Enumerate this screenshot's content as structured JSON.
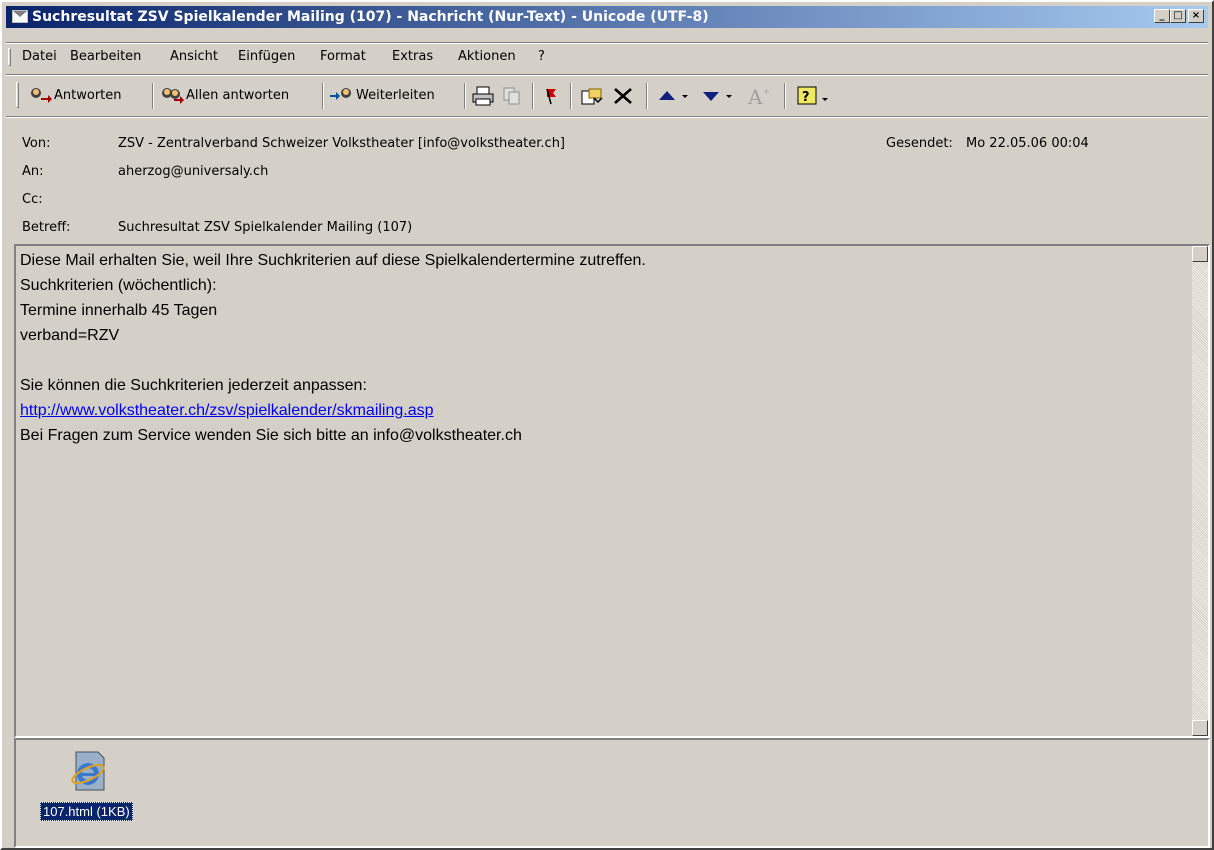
{
  "window": {
    "title": "Suchresultat ZSV Spielkalender Mailing (107) - Nachricht (Nur-Text)  - Unicode (UTF-8)",
    "controls": {
      "minimize": "_",
      "maximize": "□",
      "close": "×"
    }
  },
  "menu": {
    "items": [
      "Datei",
      "Bearbeiten",
      "Ansicht",
      "Einfügen",
      "Format",
      "Extras",
      "Aktionen",
      "?"
    ]
  },
  "toolbar": {
    "reply": "Antworten",
    "reply_all": "Allen antworten",
    "forward": "Weiterleiten"
  },
  "header": {
    "from_label": "Von:",
    "from_value": "ZSV - Zentralverband Schweizer Volkstheater [info@volkstheater.ch]",
    "sent_label": "Gesendet:",
    "sent_value": "Mo 22.05.06 00:04",
    "to_label": "An:",
    "to_value": "aherzog@universaly.ch",
    "cc_label": "Cc:",
    "cc_value": "",
    "subject_label": "Betreff:",
    "subject_value": "Suchresultat ZSV Spielkalender Mailing (107)"
  },
  "body": {
    "line1": "Diese Mail erhalten Sie, weil Ihre Suchkriterien auf diese Spielkalendertermine zutreffen.",
    "line2": "Suchkriterien (wöchentlich):",
    "line3": "Termine innerhalb 45 Tagen",
    "line4": "verband=RZV",
    "line5": "",
    "line6": "Sie können die Suchkriterien jederzeit anpassen:",
    "link": "http://www.volkstheater.ch/zsv/spielkalender/skmailing.asp",
    "line8": "Bei Fragen zum Service wenden Sie sich bitte an info@volkstheater.ch"
  },
  "attachment": {
    "name": "107.html (1KB)",
    "icon": "ie-document-icon"
  }
}
